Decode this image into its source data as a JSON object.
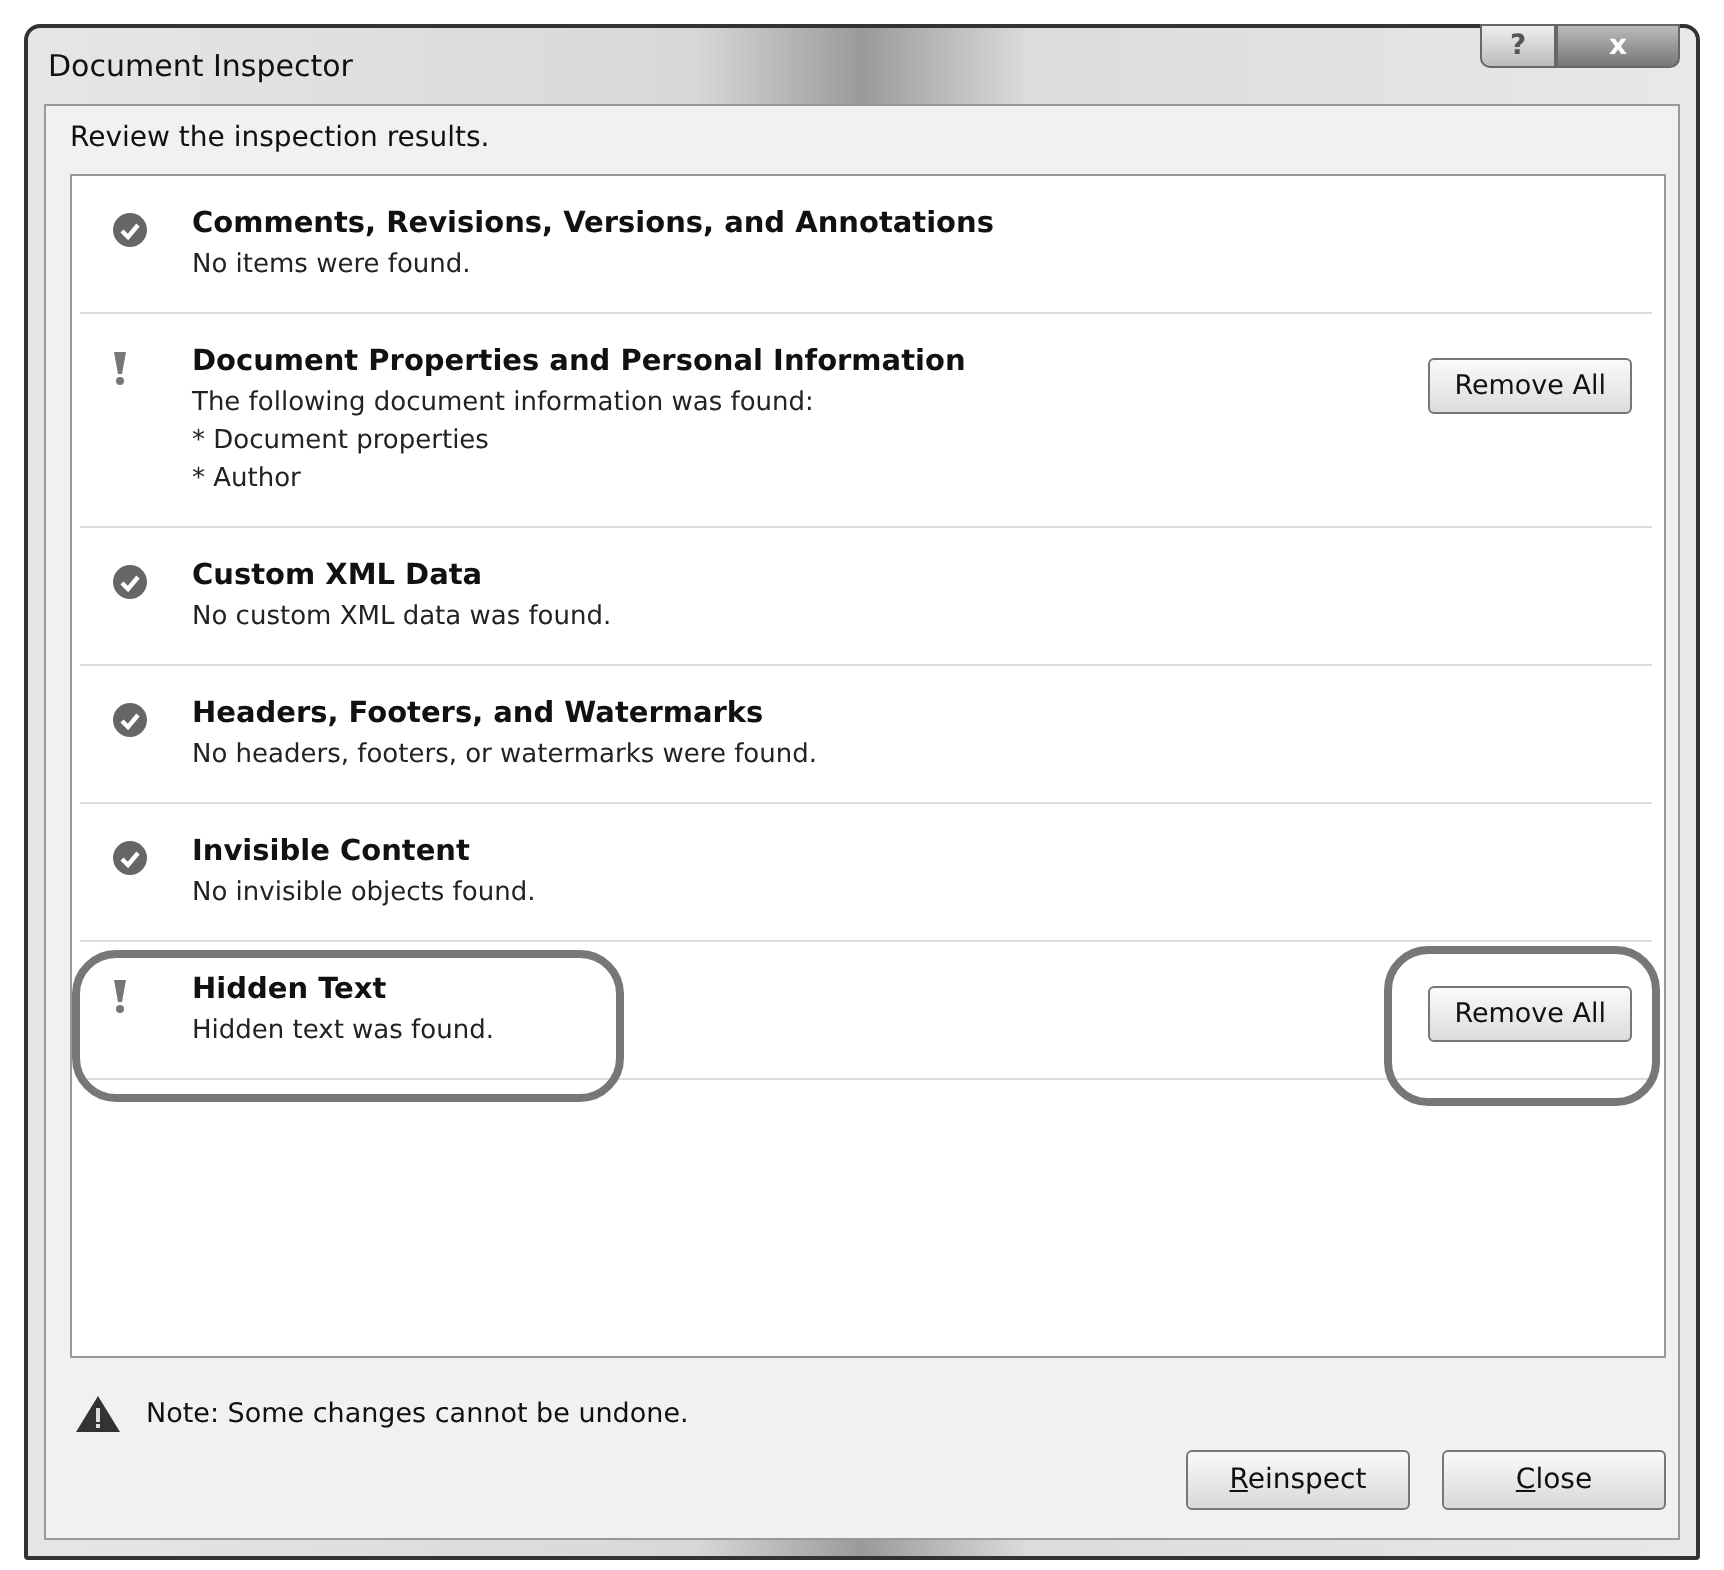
{
  "window": {
    "title": "Document Inspector",
    "title_buttons": [
      {
        "kind": "help",
        "label": "?"
      },
      {
        "kind": "close",
        "label": "x"
      }
    ]
  },
  "intro": "Review the inspection results.",
  "results": [
    {
      "kind": "ok",
      "title": "Comments, Revisions, Versions, and Annotations",
      "lines": [
        "No items were found."
      ],
      "highlighted": false
    },
    {
      "kind": "found",
      "title": "Document Properties and Personal Information",
      "lines": [
        "The following document information was found:",
        "* Document properties",
        "* Author"
      ],
      "button": "Remove All",
      "highlighted": false
    },
    {
      "kind": "ok",
      "title": "Custom XML Data",
      "lines": [
        "No custom XML data was found."
      ],
      "highlighted": false
    },
    {
      "kind": "ok",
      "title": "Headers, Footers, and Watermarks",
      "lines": [
        "No headers, footers, or watermarks were found."
      ],
      "highlighted": false
    },
    {
      "kind": "ok",
      "title": "Invisible Content",
      "lines": [
        "No invisible objects found."
      ],
      "highlighted": false
    },
    {
      "kind": "found",
      "title": "Hidden Text",
      "lines": [
        "Hidden text was found."
      ],
      "button": "Remove All",
      "highlighted": true
    }
  ],
  "note": "Note: Some changes cannot be undone.",
  "buttons": [
    {
      "label": "Reinspect"
    },
    {
      "label": "Close"
    }
  ]
}
